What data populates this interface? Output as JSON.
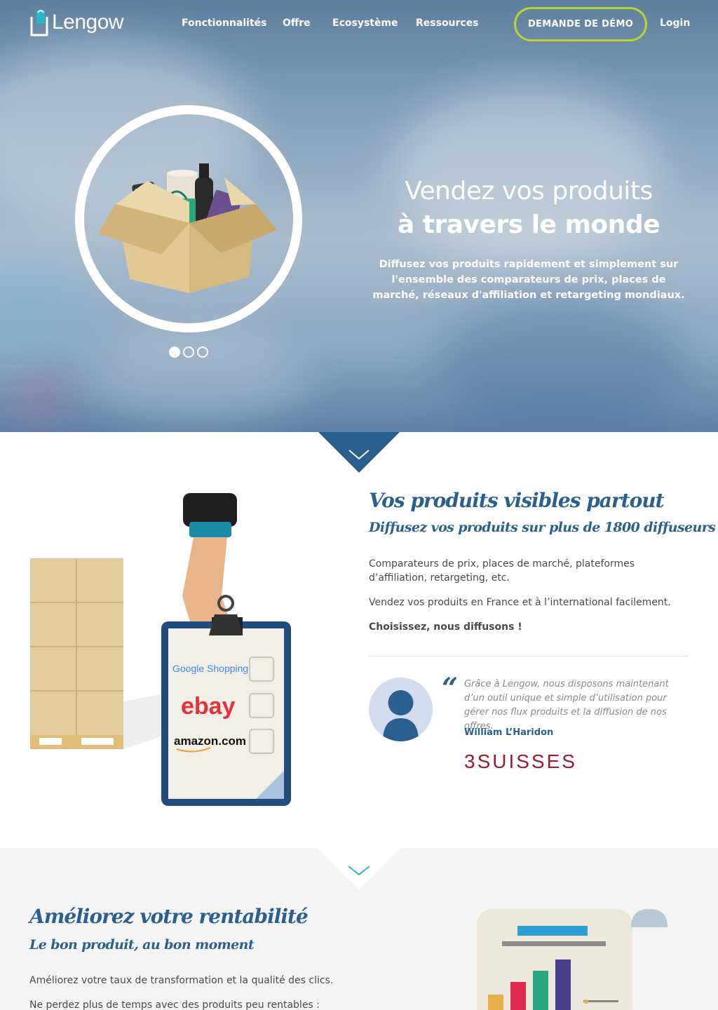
{
  "nav": {
    "logo_text": "Lengow",
    "items": [
      "Fonctionnalités",
      "Offre",
      "Ecosystème",
      "Ressources"
    ],
    "demo_button": "DEMANDE DE DÉMO",
    "login": "Login"
  },
  "hero": {
    "title_line1": "Vendez vos produits",
    "title_line2": "à travers le monde",
    "description": "Diffusez vos produits rapidement et simplement sur l'ensemble des comparateurs de prix, places de marché, réseaux d'affiliation et retargeting mondiaux.",
    "slides": 3,
    "active_slide": 1
  },
  "section_visible": {
    "title": "Vos produits visibles partout",
    "subtitle": "Diffusez vos produits sur plus de 1800 diffuseurs",
    "paragraphs": [
      "Comparateurs de prix, places de marché, plateformes d’affiliation, retargeting, etc.",
      "Vendez vos produits en France et à l’international facilement.",
      "Choisissez, nous diffusons !"
    ],
    "channels": [
      "Google Shopping",
      "ebay",
      "amazon.com"
    ],
    "testimonial": {
      "quote": "Grâce à Lengow, nous disposons maintenant d’un outil unique et simple d’utilisation pour gérer nos flux produits et la diffusion de nos offres.",
      "author": "William L’Haridon",
      "company_logo": "3SUISSES"
    }
  },
  "section_rentabilite": {
    "title": "Améliorez votre rentabilité",
    "subtitle": "Le bon produit, au bon moment",
    "paragraphs": [
      "Améliorez votre taux de transformation et la qualité des clics.",
      "Ne perdez plus de temps avec des produits peu rentables :"
    ]
  },
  "colors": {
    "brand_blue": "#2b5f8f",
    "accent_green": "#b7d432",
    "teal": "#2bb5c9"
  }
}
